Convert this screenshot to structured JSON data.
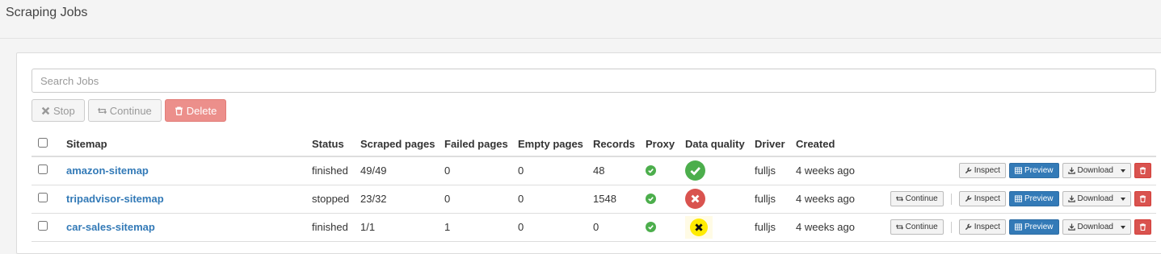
{
  "page": {
    "title": "Scraping Jobs"
  },
  "search": {
    "placeholder": "Search Jobs"
  },
  "bulk_actions": {
    "stop": "Stop",
    "continue": "Continue",
    "delete": "Delete"
  },
  "columns": {
    "sitemap": "Sitemap",
    "status": "Status",
    "scraped": "Scraped pages",
    "failed": "Failed pages",
    "empty": "Empty pages",
    "records": "Records",
    "proxy": "Proxy",
    "quality": "Data quality",
    "driver": "Driver",
    "created": "Created"
  },
  "row_actions": {
    "continue": "Continue",
    "inspect": "Inspect",
    "preview": "Preview",
    "download": "Download"
  },
  "colors": {
    "link": "#337ab7",
    "success": "#4cae4c",
    "danger": "#d9534f",
    "warning": "#ffeb00",
    "primary": "#337ab7"
  },
  "jobs": [
    {
      "sitemap": "amazon-sitemap",
      "status": "finished",
      "scraped": "49/49",
      "failed": "0",
      "empty": "0",
      "records": "48",
      "proxy": "check-icon",
      "quality": "good",
      "driver": "fulljs",
      "created": "4 weeks ago",
      "show_continue": false
    },
    {
      "sitemap": "tripadvisor-sitemap",
      "status": "stopped",
      "scraped": "23/32",
      "failed": "0",
      "empty": "0",
      "records": "1548",
      "proxy": "check-icon",
      "quality": "bad",
      "driver": "fulljs",
      "created": "4 weeks ago",
      "show_continue": true
    },
    {
      "sitemap": "car-sales-sitemap",
      "status": "finished",
      "scraped": "1/1",
      "failed": "1",
      "empty": "0",
      "records": "0",
      "proxy": "check-icon",
      "quality": "warning",
      "driver": "fulljs",
      "created": "4 weeks ago",
      "show_continue": true
    }
  ]
}
